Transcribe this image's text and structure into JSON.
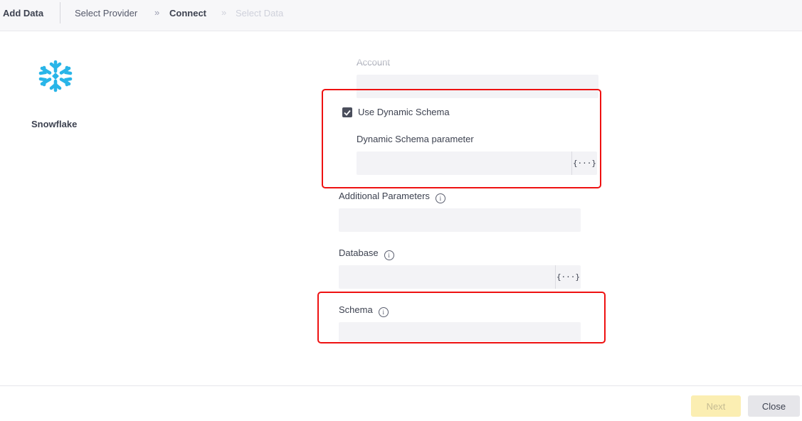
{
  "header": {
    "title": "Add Data",
    "breadcrumbs": [
      {
        "label": "Select Provider",
        "state": "done"
      },
      {
        "label": "Connect",
        "state": "active"
      },
      {
        "label": "Select Data",
        "state": "disabled"
      }
    ],
    "separator": "»"
  },
  "provider": {
    "name": "Snowflake",
    "icon": "snowflake-icon",
    "color": "#29b5e8"
  },
  "form": {
    "account_label": "Account",
    "account_value": "",
    "use_dynamic_schema_label": "Use Dynamic Schema",
    "use_dynamic_schema_checked": true,
    "dynamic_schema_param_label": "Dynamic Schema parameter",
    "dynamic_schema_param_value": "",
    "additional_params_label": "Additional Parameters",
    "additional_params_value": "",
    "database_label": "Database",
    "database_value": "",
    "schema_label": "Schema",
    "schema_value": "",
    "param_button_glyph": "{···}",
    "info_glyph": "i"
  },
  "footer": {
    "next_label": "Next",
    "next_enabled": false,
    "close_label": "Close"
  },
  "colors": {
    "highlight": "#ee1111",
    "next_disabled_bg": "#fbeeb2"
  }
}
